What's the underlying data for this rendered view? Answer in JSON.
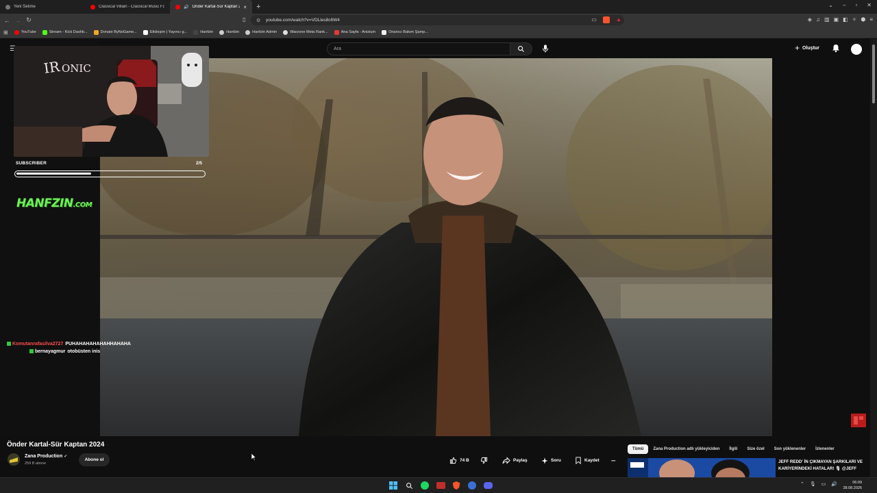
{
  "browser": {
    "tabs": [
      {
        "label": "Yeni Sekme",
        "active": false
      },
      {
        "label": "Classical Villain - Classical Music For",
        "active": false
      },
      {
        "label": "Önder Kartal-Sür Kaptan 2024",
        "active": true
      }
    ],
    "url": "youtube.com/watch?v=VDLles8c6W4",
    "bookmarks": [
      {
        "label": "YouTube",
        "color": "#ff0000"
      },
      {
        "label": "Stream - Kick Dashb...",
        "color": "#53fc18"
      },
      {
        "label": "Donate ByNoGame...",
        "color": "#f5a623"
      },
      {
        "label": "Etkileşim | Yayıncı g...",
        "color": "#ffffff"
      },
      {
        "label": "Hanfzin",
        "color": "#444444"
      },
      {
        "label": "Hanfzin",
        "color": "#cccccc"
      },
      {
        "label": "Hanfzin Admin",
        "color": "#cccccc"
      },
      {
        "label": "Warzone Meta Rank...",
        "color": "#dddddd"
      },
      {
        "label": "Ana Sayfa - Anizium",
        "color": "#e53935"
      },
      {
        "label": "Onanıcı Bakım Şamp...",
        "color": "#f1f1f1"
      }
    ]
  },
  "youtube": {
    "search_placeholder": "Ara",
    "create_label": "Oluştur"
  },
  "overlay": {
    "sub_goal_label": "SUBSCRIBER",
    "sub_goal_count": "2/5",
    "sub_goal_progress": 0.4,
    "brand": "HANFZIN",
    "brand_suffix": ".COM",
    "chat": [
      {
        "user": "Komutanrafasilva2727",
        "message": "PUHAHAHAHAHAHHAHAHA",
        "user_color": "#ff4d4d"
      },
      {
        "user": "bernayagmur",
        "message": "otobüsten inis",
        "user_color": "#ffffff"
      }
    ]
  },
  "video": {
    "title": "Önder Kartal-Sür Kaptan 2024",
    "channel": "Zana Production",
    "subscribers": "259 B abone",
    "subscribe_label": "Abone ol",
    "likes": "74 B",
    "share_label": "Paylaş",
    "ask_label": "Soru",
    "save_label": "Kaydet"
  },
  "recommendations": {
    "chips": [
      "Tümü",
      "Zana Production adlı yükleyiciden",
      "İlgili",
      "Size özel",
      "Son yüklenenler",
      "İzlenenler"
    ],
    "first_title": "JEFF REDD' İN ÇIKMAYAN ŞARKILARI VE KARİYERİNDEKİ HATALAR! 🎙 @JEFF"
  },
  "taskbar": {
    "time": "06:09",
    "date": "28.08.2026"
  },
  "colors": {
    "accent_red": "#ff0000",
    "chat_badge": "#35c83a",
    "hanfzin_green": "#6ef05a"
  }
}
